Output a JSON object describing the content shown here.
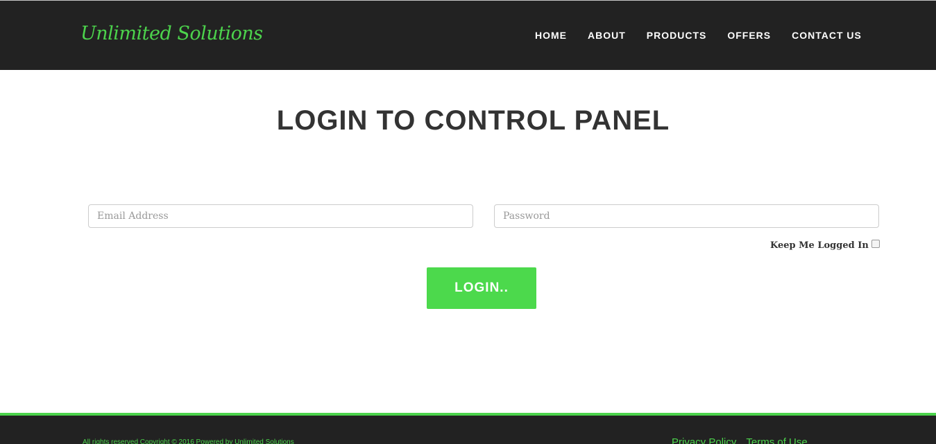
{
  "brand": {
    "name": "Unlimited Solutions"
  },
  "nav": {
    "items": [
      {
        "label": "HOME"
      },
      {
        "label": "ABOUT"
      },
      {
        "label": "PRODUCTS"
      },
      {
        "label": "OFFERS"
      },
      {
        "label": "CONTACT US"
      }
    ]
  },
  "main": {
    "title": "LOGIN TO CONTROL PANEL",
    "email": {
      "placeholder": "Email Address",
      "value": ""
    },
    "password": {
      "placeholder": "Password",
      "value": ""
    },
    "remember": {
      "label": "Keep Me Logged In",
      "checked": false
    },
    "login_label": "LOGIN.."
  },
  "footer": {
    "copyright": "All rights reserved Copyright © 2016 Powered by Unlimited Solutions",
    "links": [
      {
        "label": "Privacy Policy"
      },
      {
        "label": "Terms of Use"
      }
    ]
  },
  "colors": {
    "accent": "#4cd34c",
    "button": "#4cd94c",
    "navbar": "#222222",
    "title": "#333333"
  }
}
